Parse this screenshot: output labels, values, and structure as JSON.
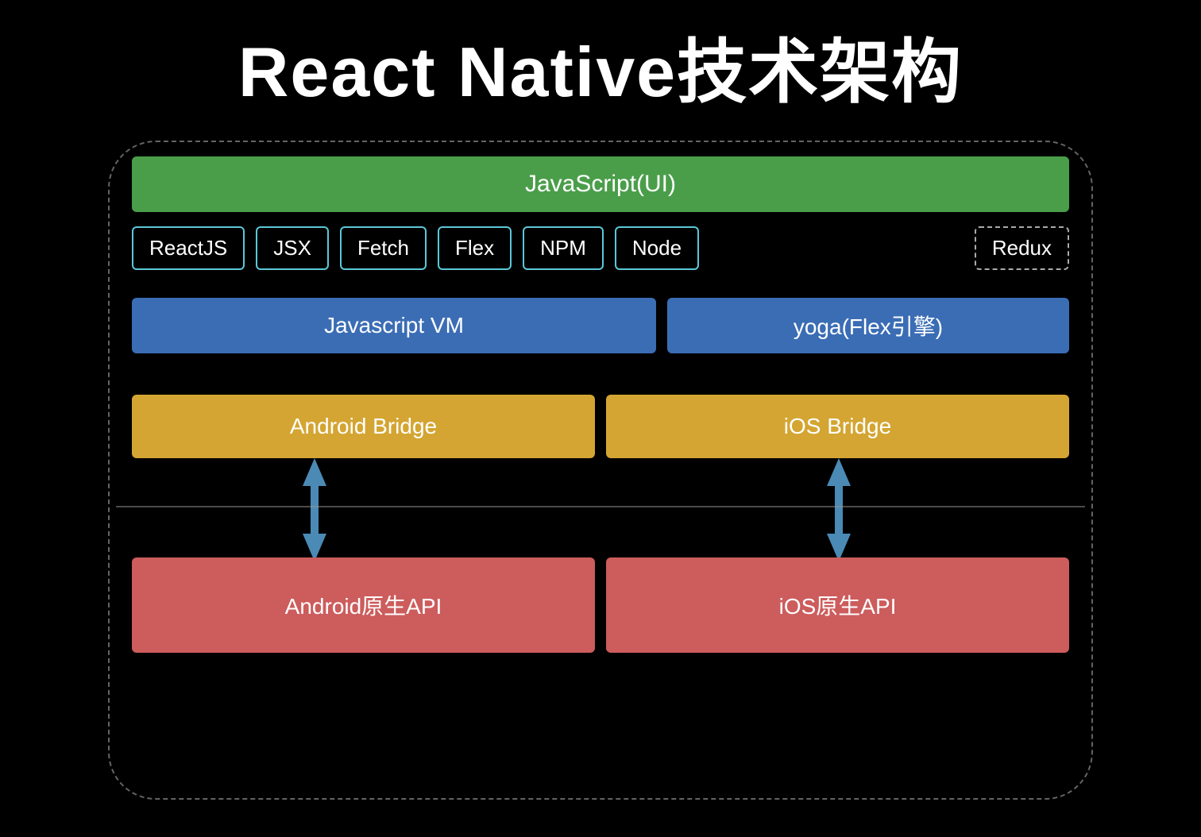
{
  "title": "React Native技术架构",
  "layers": {
    "js_ui": {
      "label": "JavaScript(UI)"
    },
    "pills": [
      {
        "id": "reactjs",
        "label": "ReactJS",
        "style": "solid"
      },
      {
        "id": "jsx",
        "label": "JSX",
        "style": "solid"
      },
      {
        "id": "fetch",
        "label": "Fetch",
        "style": "solid"
      },
      {
        "id": "flex",
        "label": "Flex",
        "style": "solid"
      },
      {
        "id": "npm",
        "label": "NPM",
        "style": "solid"
      },
      {
        "id": "node",
        "label": "Node",
        "style": "solid"
      },
      {
        "id": "redux",
        "label": "Redux",
        "style": "dashed"
      }
    ],
    "vm": {
      "label": "Javascript VM"
    },
    "yoga": {
      "label": "yoga(Flex引擎)"
    },
    "android_bridge": {
      "label": "Android Bridge"
    },
    "ios_bridge": {
      "label": "iOS Bridge"
    },
    "android_api": {
      "label": "Android原生API"
    },
    "ios_api": {
      "label": "iOS原生API"
    }
  },
  "colors": {
    "background": "#000000",
    "js_ui_bg": "#4a9e4a",
    "pill_border": "#5bc8d8",
    "vm_bg": "#3b6db5",
    "bridge_bg": "#d4a532",
    "native_bg": "#cd5c5c",
    "text": "#ffffff",
    "arrow": "#4a8ab5"
  }
}
